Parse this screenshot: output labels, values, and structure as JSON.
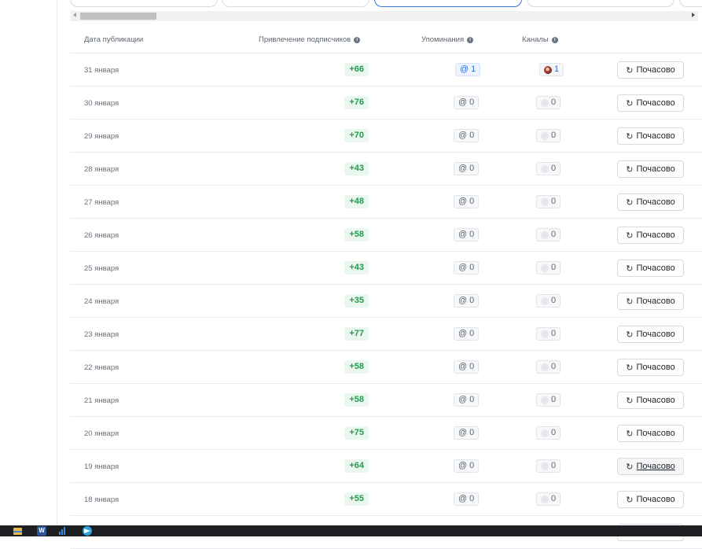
{
  "table": {
    "headers": {
      "date": "Дата публикации",
      "subscribers": "Привлечение подписчиков",
      "mentions": "Упоминания",
      "channels": "Каналы"
    },
    "rows": [
      {
        "date": "31 января",
        "subscribers": "+66",
        "mentions": "1",
        "channels": "1",
        "highlight": true,
        "button": "Почасово"
      },
      {
        "date": "30 января",
        "subscribers": "+76",
        "mentions": "0",
        "channels": "0",
        "highlight": false,
        "button": "Почасово"
      },
      {
        "date": "29 января",
        "subscribers": "+70",
        "mentions": "0",
        "channels": "0",
        "highlight": false,
        "button": "Почасово"
      },
      {
        "date": "28 января",
        "subscribers": "+43",
        "mentions": "0",
        "channels": "0",
        "highlight": false,
        "button": "Почасово"
      },
      {
        "date": "27 января",
        "subscribers": "+48",
        "mentions": "0",
        "channels": "0",
        "highlight": false,
        "button": "Почасово"
      },
      {
        "date": "26 января",
        "subscribers": "+58",
        "mentions": "0",
        "channels": "0",
        "highlight": false,
        "button": "Почасово"
      },
      {
        "date": "25 января",
        "subscribers": "+43",
        "mentions": "0",
        "channels": "0",
        "highlight": false,
        "button": "Почасово"
      },
      {
        "date": "24 января",
        "subscribers": "+35",
        "mentions": "0",
        "channels": "0",
        "highlight": false,
        "button": "Почасово"
      },
      {
        "date": "23 января",
        "subscribers": "+77",
        "mentions": "0",
        "channels": "0",
        "highlight": false,
        "button": "Почасово"
      },
      {
        "date": "22 января",
        "subscribers": "+58",
        "mentions": "0",
        "channels": "0",
        "highlight": false,
        "button": "Почасово"
      },
      {
        "date": "21 января",
        "subscribers": "+58",
        "mentions": "0",
        "channels": "0",
        "highlight": false,
        "button": "Почасово"
      },
      {
        "date": "20 января",
        "subscribers": "+75",
        "mentions": "0",
        "channels": "0",
        "highlight": false,
        "button": "Почасово"
      },
      {
        "date": "19 января",
        "subscribers": "+64",
        "mentions": "0",
        "channels": "0",
        "highlight": false,
        "button": "Почасово",
        "hover": true
      },
      {
        "date": "18 января",
        "subscribers": "+55",
        "mentions": "0",
        "channels": "0",
        "highlight": false,
        "button": "Почасово"
      }
    ]
  },
  "icons": {
    "mention": "at-icon",
    "refresh": "refresh-icon",
    "info": "info-icon"
  },
  "colors": {
    "positive": "#1f9d4c",
    "positive_bg": "#eaf7ee",
    "accent": "#3a74d9"
  }
}
